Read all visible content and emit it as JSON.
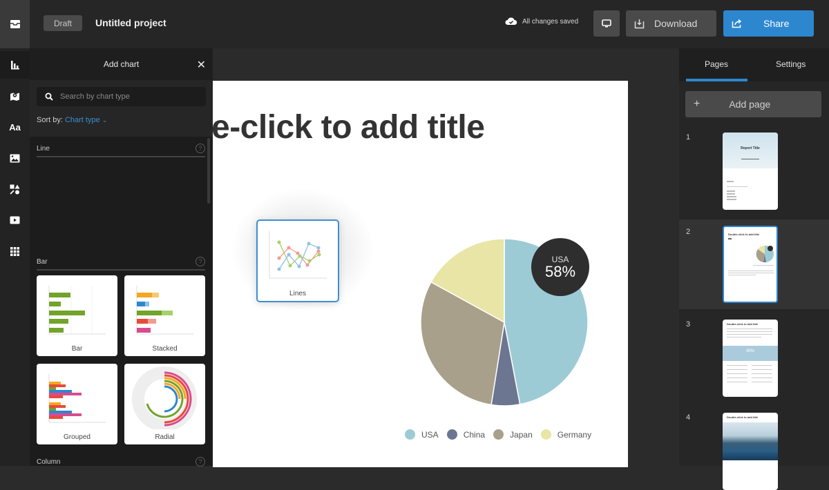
{
  "topbar": {
    "logo_icon": "inbox-tray-icon",
    "draft_label": "Draft",
    "project_title": "Untitled project",
    "save_status": "All changes saved",
    "save_icon": "cloud-check-icon",
    "present_icon": "monitor-icon",
    "download_label": "Download",
    "download_icon": "download-tray-icon",
    "share_label": "Share",
    "share_icon": "share-arrow-icon"
  },
  "rail": {
    "items": [
      {
        "name": "charts",
        "icon": "bar-chart-icon"
      },
      {
        "name": "maps",
        "icon": "map-pin-icon"
      },
      {
        "name": "text",
        "icon": "text-aa-icon"
      },
      {
        "name": "images",
        "icon": "image-icon"
      },
      {
        "name": "shapes",
        "icon": "shapes-icon"
      },
      {
        "name": "video",
        "icon": "play-video-icon"
      },
      {
        "name": "more",
        "icon": "grid-dots-icon"
      }
    ]
  },
  "panel": {
    "title": "Add chart",
    "close_icon": "close-icon",
    "search_placeholder": "Search by chart type",
    "sort_label": "Sort by:",
    "sort_value": "Chart type",
    "sections": [
      {
        "title": "Line",
        "tiles": []
      },
      {
        "title": "Bar",
        "tiles": [
          {
            "label": "Bar"
          },
          {
            "label": "Stacked"
          },
          {
            "label": "Grouped"
          },
          {
            "label": "Radial"
          }
        ]
      },
      {
        "title": "Column",
        "tiles": []
      }
    ]
  },
  "canvas": {
    "page_title": "e-click to add title",
    "dragging_tile_label": "Lines",
    "highlight": {
      "country": "USA",
      "percent": "58%"
    }
  },
  "chart_data": {
    "type": "pie",
    "title": "",
    "categories": [
      "USA",
      "China",
      "Japan",
      "Germany"
    ],
    "values": [
      47,
      5.5,
      30.5,
      17
    ],
    "colors": [
      "#9ccbd6",
      "#6d7690",
      "#a8a08a",
      "#e8e5a6"
    ],
    "annotation": {
      "label": "USA",
      "value": "58%"
    },
    "legend": "bottom"
  },
  "right_panel": {
    "tabs": [
      {
        "label": "Pages",
        "active": true
      },
      {
        "label": "Settings",
        "active": false
      }
    ],
    "add_page_label": "Add page",
    "pages": [
      {
        "number": "1",
        "title": "Report Title",
        "selected": false
      },
      {
        "number": "2",
        "title": "Double-click to add title",
        "selected": true
      },
      {
        "number": "3",
        "title": "Double-click to add title",
        "stat": "45%",
        "selected": false
      },
      {
        "number": "4",
        "title": "Double-click to add title",
        "selected": false
      }
    ]
  },
  "colors": {
    "accent": "#2d87cf",
    "topbar": "#262626",
    "panel": "#1c1c1c"
  }
}
